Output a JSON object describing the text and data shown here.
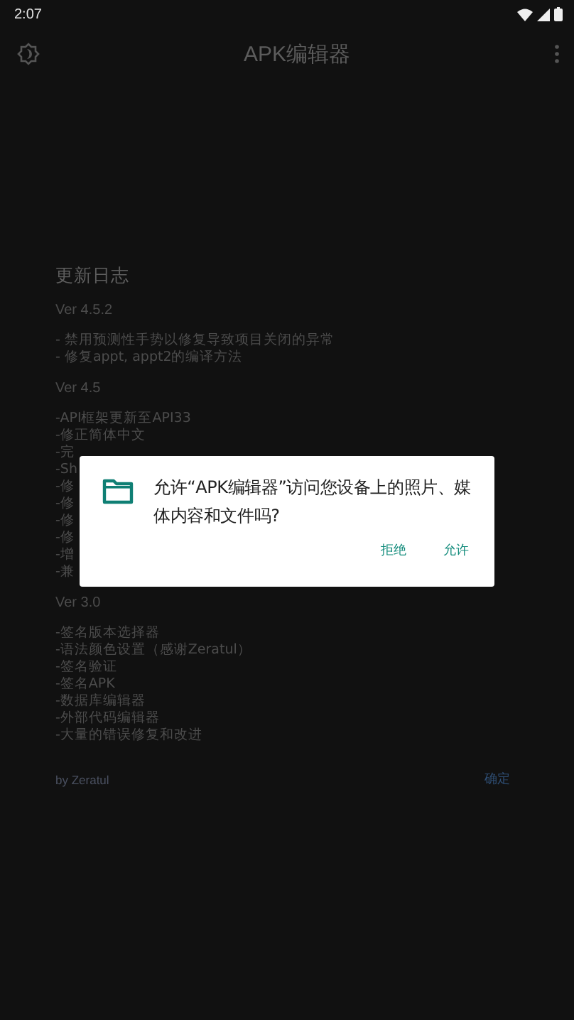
{
  "status_bar": {
    "time": "2:07"
  },
  "app_bar": {
    "title": "APK编辑器"
  },
  "changelog": {
    "title": "更新日志",
    "sections": [
      {
        "version": "Ver 4.5.2",
        "lines": [
          "- 禁用预测性手势以修复导致项目关闭的异常",
          "- 修复appt, appt2的编译方法"
        ]
      },
      {
        "version": "Ver 4.5",
        "lines": [
          "-API框架更新至API33",
          "-修正简体中文",
          "-完",
          "-Sh",
          "-修",
          "-修",
          "-修",
          "-修",
          "-增",
          "-兼"
        ]
      },
      {
        "version": "Ver 3.0",
        "lines": [
          "-签名版本选择器",
          "-语法颜色设置（感谢Zeratul）",
          "-签名验证",
          "-签名APK",
          "-数据库编辑器",
          "-外部代码编辑器",
          "-大量的错误修复和改进"
        ]
      }
    ],
    "author": "by Zeratul",
    "ok_button": "确定"
  },
  "permission_dialog": {
    "message": "允许“APK编辑器”访问您设备上的照片、媒体内容和文件吗?",
    "buttons": [
      "拒绝",
      "允许"
    ]
  }
}
